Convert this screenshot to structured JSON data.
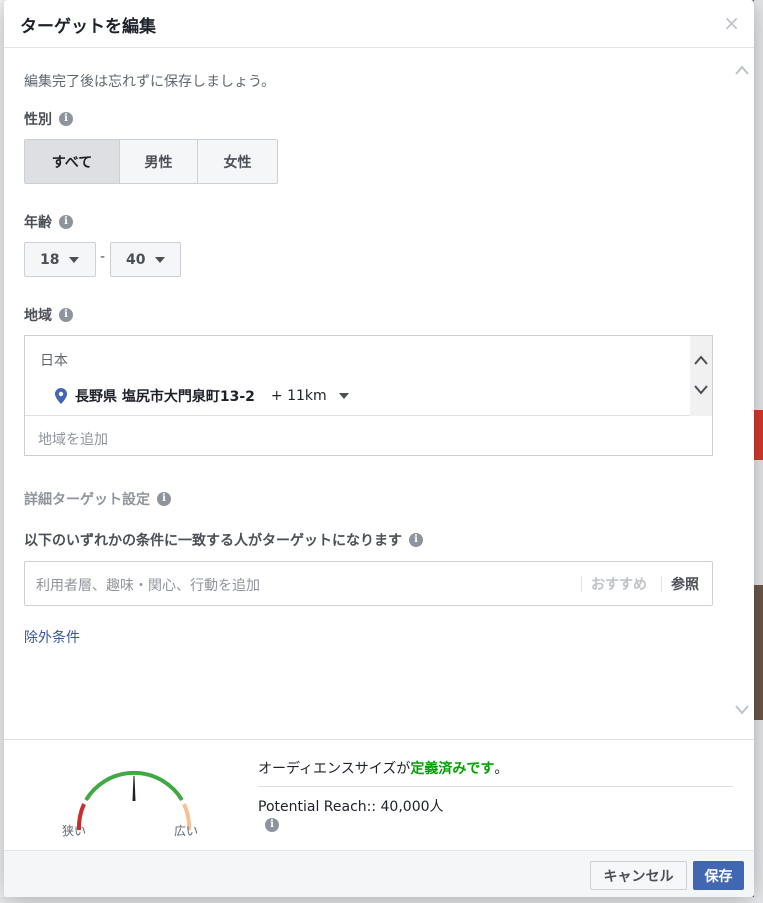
{
  "modal": {
    "title": "ターゲットを編集",
    "close_glyph": "×"
  },
  "note": "編集完了後は忘れずに保存しましょう。",
  "gender": {
    "label": "性別",
    "options": [
      "すべて",
      "男性",
      "女性"
    ],
    "selected": "すべて"
  },
  "age": {
    "label": "年齢",
    "min": "18",
    "separator": "-",
    "max": "40"
  },
  "location": {
    "label": "地域",
    "country": "日本",
    "item_name": "長野県 塩尻市大門泉町13-2",
    "item_radius": "+ 11km",
    "add_placeholder": "地域を追加"
  },
  "detailed": {
    "label": "詳細ターゲット設定",
    "condition_label": "以下のいずれかの条件に一致する人がターゲットになります",
    "search_placeholder": "利用者層、趣味・関心、行動を追加",
    "recommend": "おすすめ",
    "browse": "参照",
    "exclude": "除外条件"
  },
  "audience": {
    "title_prefix": "オーディエンスサイズが",
    "title_status": "定義済みです",
    "title_suffix": "。",
    "reach": "Potential Reach:: 40,000人",
    "narrow": "狭い",
    "wide": "広い",
    "level": 0.5,
    "colors": {
      "red": "#c92e2e",
      "green": "#42a845",
      "orange": "#f7c098"
    }
  },
  "icons": {
    "info": "i",
    "close": "close-icon",
    "pin": "location-pin-icon"
  },
  "footer": {
    "cancel": "キャンセル",
    "save": "保存"
  }
}
